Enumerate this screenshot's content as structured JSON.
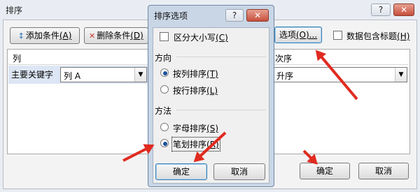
{
  "main": {
    "title": "排序",
    "help_glyph": "?",
    "close_glyph": "✕",
    "toolbar": {
      "add_icon": "↕",
      "add_label": "添加条件",
      "add_key": "(A)",
      "delete_icon": "✕",
      "delete_label": "删除条件",
      "delete_key": "(D)",
      "options_label": "选项",
      "options_key": "(O)...",
      "header_checkbox_label": "数据包含标题",
      "header_checkbox_key": "(H)",
      "header_checkbox_checked": false
    },
    "grid": {
      "col_header": "列",
      "order_header": "次序",
      "row_label": "主要关键字",
      "column_value": "列 A",
      "order_value": "升序"
    },
    "ok_label": "确定",
    "cancel_label": "取消"
  },
  "dialog": {
    "title": "排序选项",
    "help_glyph": "?",
    "close_glyph": "✕",
    "case_label": "区分大小写",
    "case_key": "(C)",
    "case_checked": false,
    "direction_title": "方向",
    "direction_options": [
      {
        "label": "按列排序",
        "key": "(T)",
        "selected": true
      },
      {
        "label": "按行排序",
        "key": "(L)",
        "selected": false
      }
    ],
    "method_title": "方法",
    "method_options": [
      {
        "label": "字母排序",
        "key": "(S)",
        "selected": false
      },
      {
        "label": "笔划排序",
        "key": "(R)",
        "selected": true
      }
    ],
    "ok_label": "确定",
    "cancel_label": "取消"
  },
  "annotation_color": "#e02b20"
}
